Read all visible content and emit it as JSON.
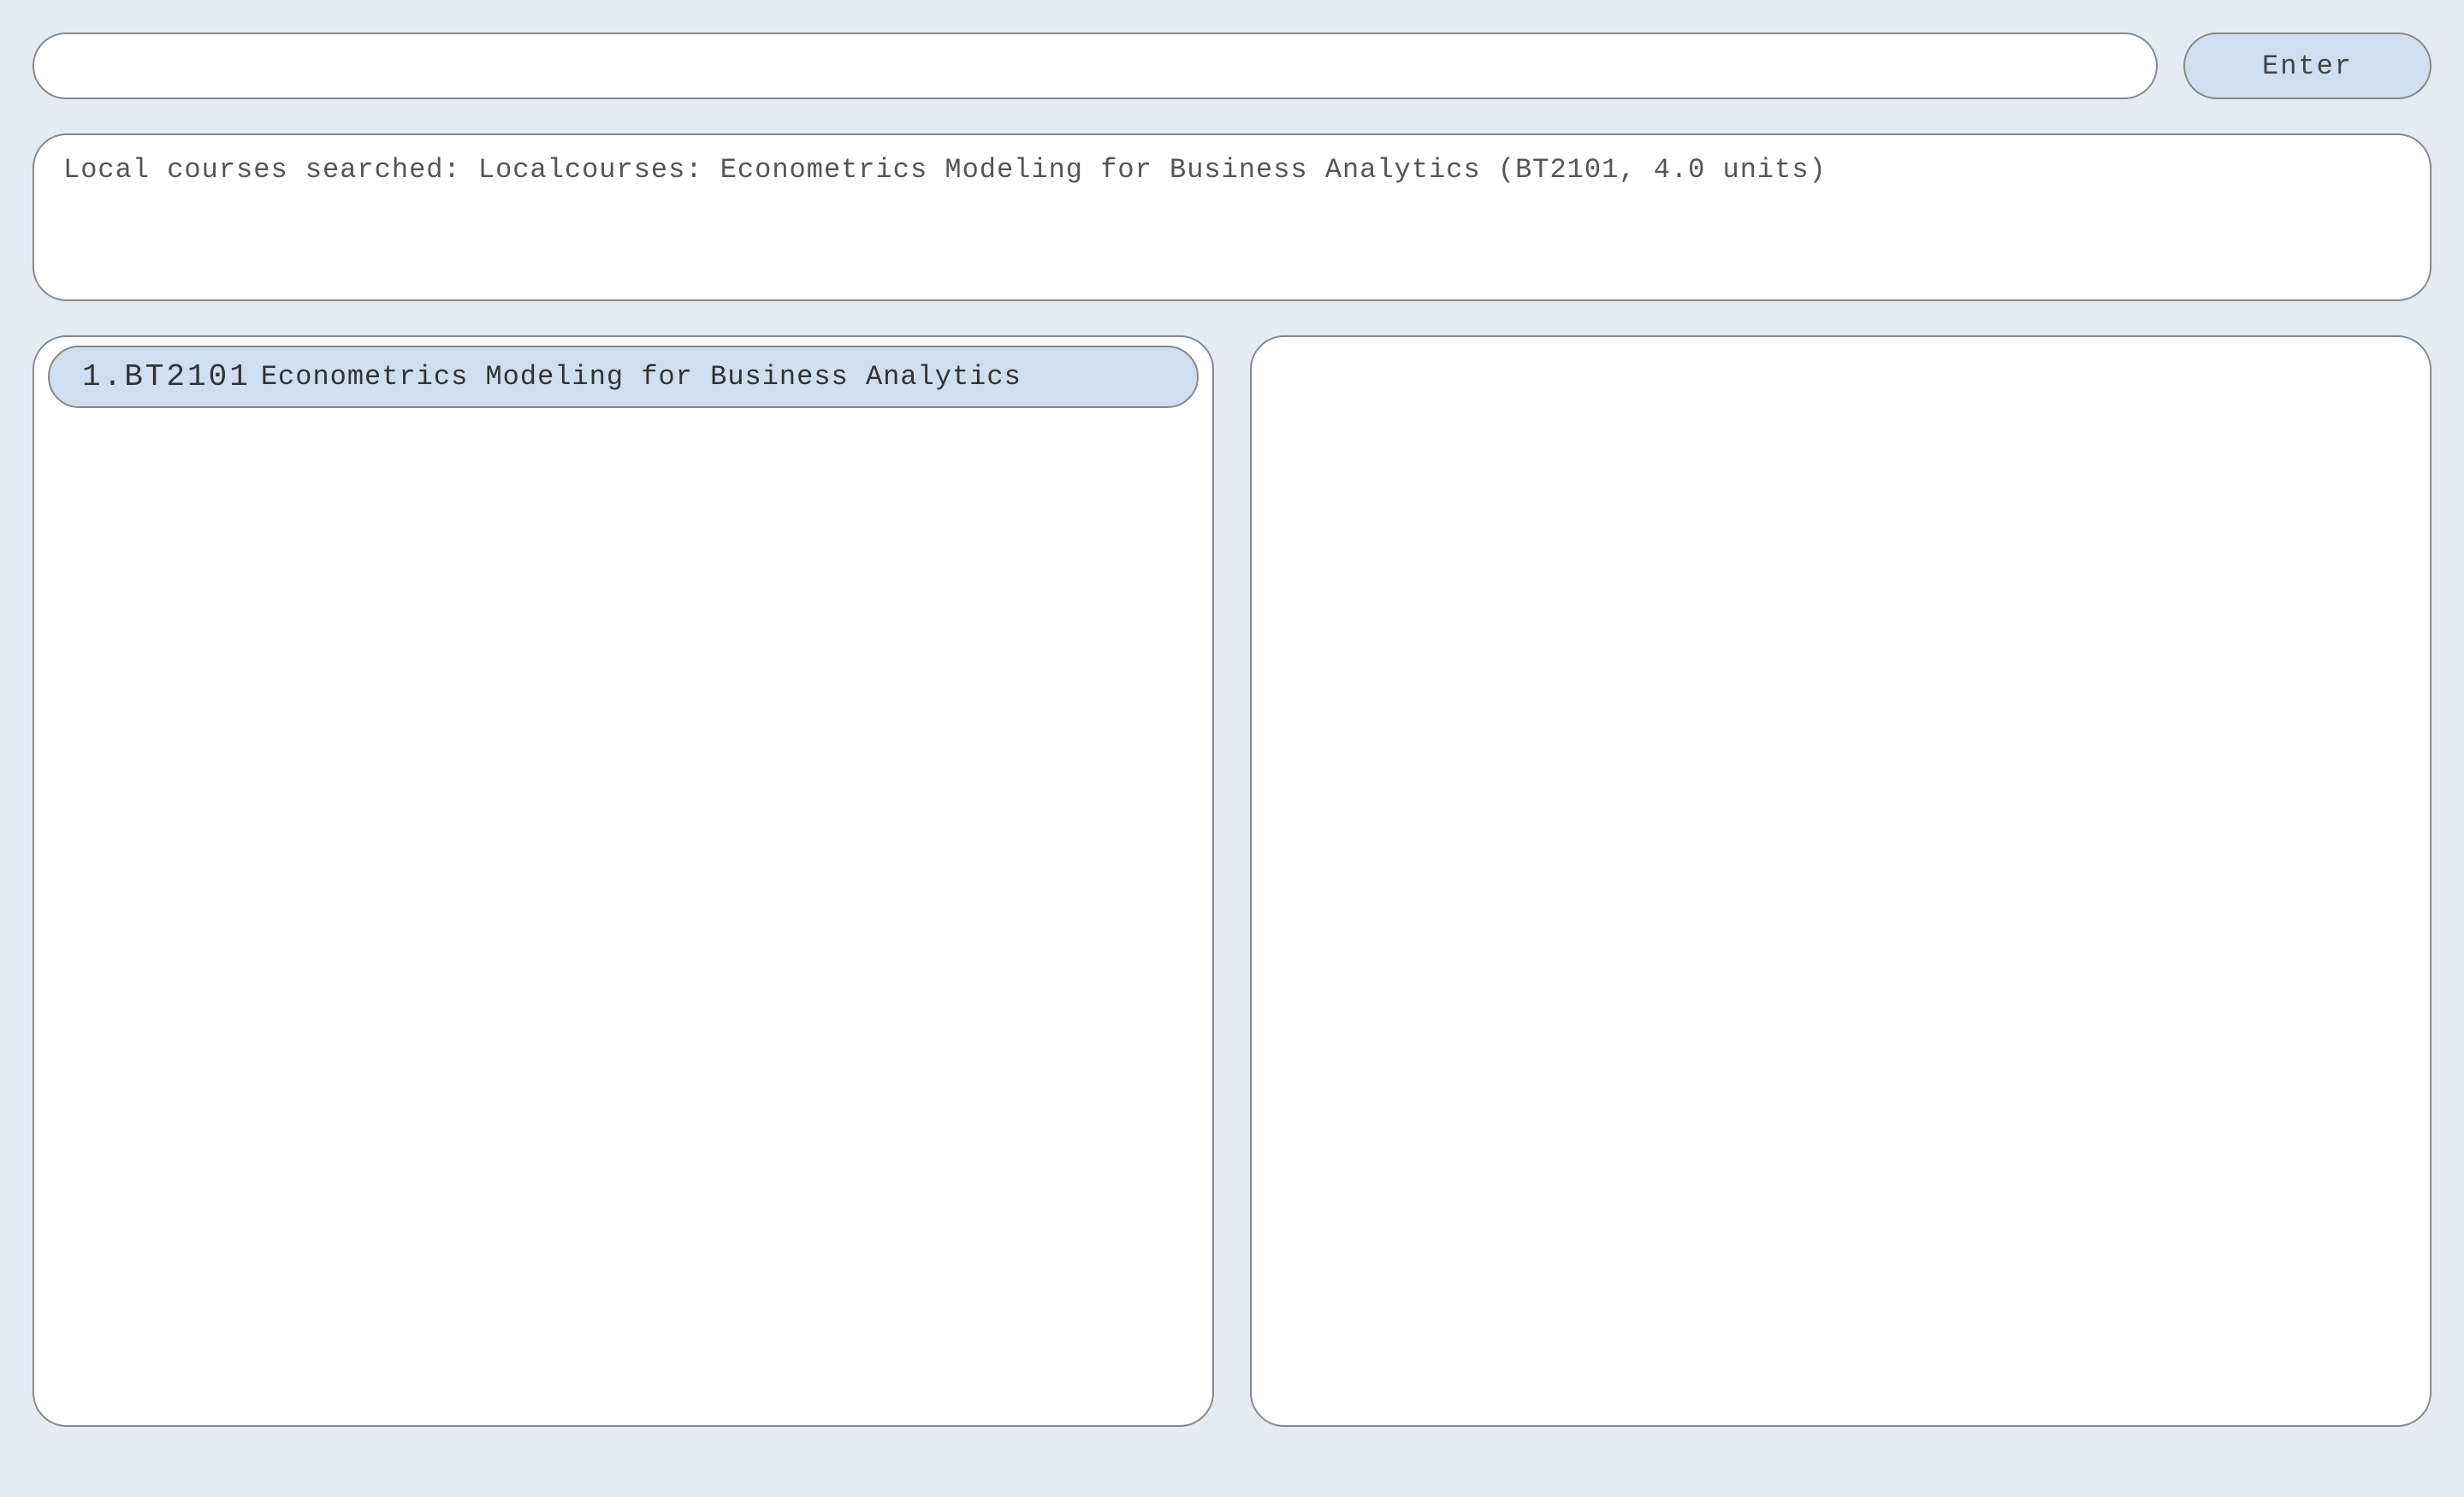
{
  "top": {
    "search_value": "",
    "enter_label": "Enter"
  },
  "status": {
    "text": "Local courses searched: Localcourses: Econometrics Modeling for Business Analytics (BT2101, 4.0 units)"
  },
  "left_panel": {
    "items": [
      {
        "index_code": "1.BT2101",
        "title": "Econometrics Modeling for Business Analytics"
      }
    ]
  }
}
